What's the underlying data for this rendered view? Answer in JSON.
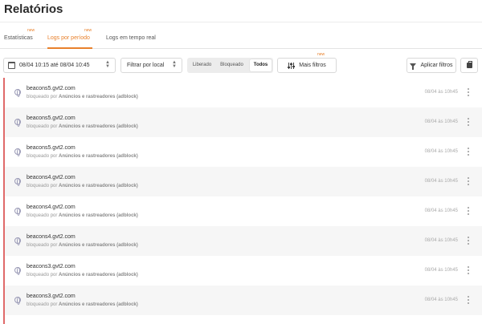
{
  "page": {
    "title": "Relatórios"
  },
  "tabs": [
    {
      "label": "Estatísticas",
      "badge": "new",
      "active": false
    },
    {
      "label": "Logs por período",
      "badge": "new",
      "active": true
    },
    {
      "label": "Logs em tempo real",
      "active": false
    }
  ],
  "toolbar": {
    "date_range": "08/04 10:15 até 08/04 10:45",
    "local_filter": "Filtrar por local",
    "segments": [
      "Liberado",
      "Bloqueado",
      "Todos"
    ],
    "selected_segment": "Todos",
    "more_filters_label": "Mais filtros",
    "more_filters_badge": "new",
    "apply_label": "Aplicar filtros"
  },
  "colors": {
    "accent": "#e8812c",
    "blocked_bar": "#e06a6a"
  },
  "logs": [
    {
      "domain": "beacons5.gvt2.com",
      "status": "bloqueado por",
      "category": "Anúncios e rastreadores (adblock)",
      "time": "08/04 às 10h45"
    },
    {
      "domain": "beacons5.gvt2.com",
      "status": "bloqueado por",
      "category": "Anúncios e rastreadores (adblock)",
      "time": "08/04 às 10h45"
    },
    {
      "domain": "beacons5.gvt2.com",
      "status": "bloqueado por",
      "category": "Anúncios e rastreadores (adblock)",
      "time": "08/04 às 10h45"
    },
    {
      "domain": "beacons4.gvt2.com",
      "status": "bloqueado por",
      "category": "Anúncios e rastreadores (adblock)",
      "time": "08/04 às 10h45"
    },
    {
      "domain": "beacons4.gvt2.com",
      "status": "bloqueado por",
      "category": "Anúncios e rastreadores (adblock)",
      "time": "08/04 às 10h45"
    },
    {
      "domain": "beacons4.gvt2.com",
      "status": "bloqueado por",
      "category": "Anúncios e rastreadores (adblock)",
      "time": "08/04 às 10h45"
    },
    {
      "domain": "beacons3.gvt2.com",
      "status": "bloqueado por",
      "category": "Anúncios e rastreadores (adblock)",
      "time": "08/04 às 10h45"
    },
    {
      "domain": "beacons3.gvt2.com",
      "status": "bloqueado por",
      "category": "Anúncios e rastreadores (adblock)",
      "time": "08/04 às 10h45"
    }
  ]
}
